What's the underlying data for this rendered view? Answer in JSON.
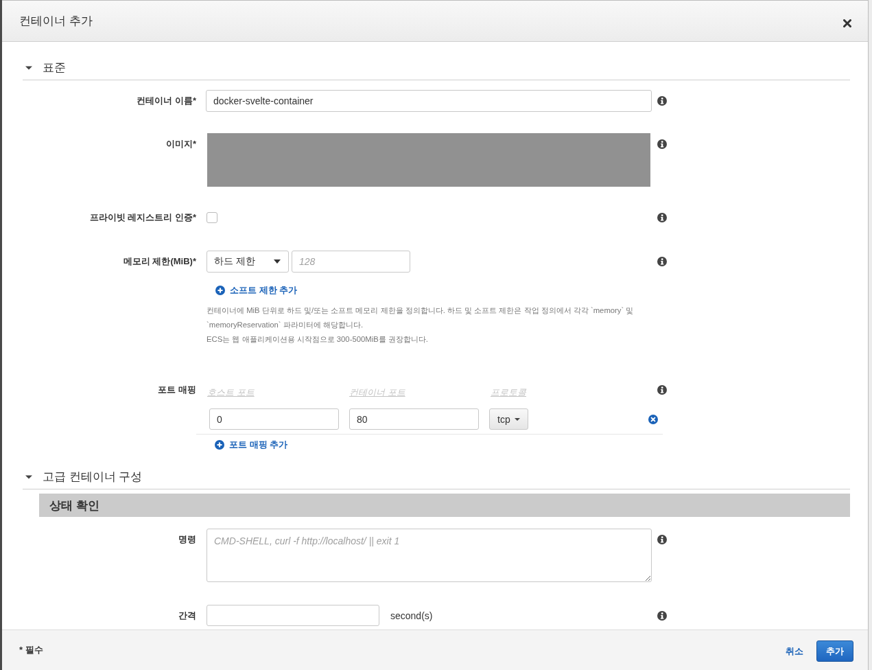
{
  "dialog": {
    "title": "컨테이너 추가"
  },
  "sections": [
    {
      "title": "표준",
      "expanded": true,
      "fields": [
        {
          "kind": "text",
          "label": "컨테이너 이름*",
          "value": "docker-svelte-container"
        },
        {
          "kind": "redacted",
          "label": "이미지*"
        },
        {
          "kind": "checkbox",
          "label": "프라이빗 레지스트리 인증*",
          "checked": false
        },
        {
          "kind": "memory",
          "label": "메모리 제한(MiB)*",
          "limit_type": "하드 제한",
          "placeholder": "128",
          "add_link": "소프트 제한 추가",
          "help": [
            "컨테이너에 MiB 단위로 하드 및/또는 소프트 메모리 제한을 정의합니다. 하드 및 소프트 제한은 작업 정의에서 각각 `memory` 및 `memoryReservation` 파라미터에 해당합니다.",
            "ECS는 웹 애플리케이션용 시작점으로 300-500MiB를 권장합니다."
          ]
        },
        {
          "kind": "port_mapping",
          "label": "포트 매핑",
          "columns": [
            "호스트 포트",
            "컨테이너 포트",
            "프로토콜"
          ],
          "rows": [
            {
              "host_port": "0",
              "container_port": "80",
              "protocol": "tcp"
            }
          ],
          "add_link": "포트 매핑 추가"
        }
      ]
    },
    {
      "title": "고급 컨테이너 구성",
      "expanded": true,
      "groups": [
        {
          "title": "상태 확인",
          "fields": [
            {
              "kind": "textarea",
              "label": "명령",
              "placeholder": "CMD-SHELL, curl -f http://localhost/ || exit 1"
            },
            {
              "kind": "unit",
              "label": "간격",
              "unit": "second(s)"
            }
          ]
        }
      ]
    }
  ],
  "footer": {
    "note": "* 필수",
    "buttons": [
      {
        "kind": "link",
        "label": "취소"
      },
      {
        "kind": "primary",
        "label": "추가"
      }
    ]
  }
}
